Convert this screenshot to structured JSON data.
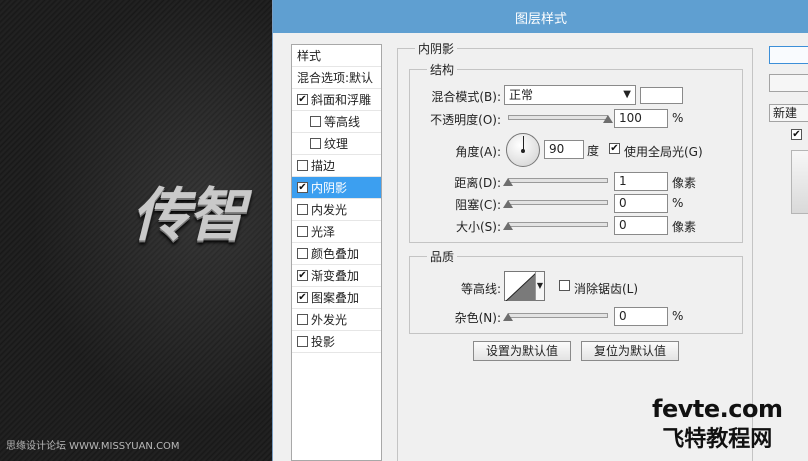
{
  "canvas": {
    "big_text": "传智",
    "watermark": "思缘设计论坛 WWW.MISSYUAN.COM"
  },
  "dialog": {
    "title": "图层样式",
    "styles_list": [
      {
        "label": "样式",
        "checkbox": false,
        "checked": false,
        "indent": 0,
        "selected": false
      },
      {
        "label": "混合选项:默认",
        "checkbox": false,
        "checked": false,
        "indent": 0,
        "selected": false
      },
      {
        "label": "斜面和浮雕",
        "checkbox": true,
        "checked": true,
        "indent": 0,
        "selected": false
      },
      {
        "label": "等高线",
        "checkbox": true,
        "checked": false,
        "indent": 1,
        "selected": false
      },
      {
        "label": "纹理",
        "checkbox": true,
        "checked": false,
        "indent": 1,
        "selected": false
      },
      {
        "label": "描边",
        "checkbox": true,
        "checked": false,
        "indent": 0,
        "selected": false
      },
      {
        "label": "内阴影",
        "checkbox": true,
        "checked": true,
        "indent": 0,
        "selected": true
      },
      {
        "label": "内发光",
        "checkbox": true,
        "checked": false,
        "indent": 0,
        "selected": false
      },
      {
        "label": "光泽",
        "checkbox": true,
        "checked": false,
        "indent": 0,
        "selected": false
      },
      {
        "label": "颜色叠加",
        "checkbox": true,
        "checked": false,
        "indent": 0,
        "selected": false
      },
      {
        "label": "渐变叠加",
        "checkbox": true,
        "checked": true,
        "indent": 0,
        "selected": false
      },
      {
        "label": "图案叠加",
        "checkbox": true,
        "checked": true,
        "indent": 0,
        "selected": false
      },
      {
        "label": "外发光",
        "checkbox": true,
        "checked": false,
        "indent": 0,
        "selected": false
      },
      {
        "label": "投影",
        "checkbox": true,
        "checked": false,
        "indent": 0,
        "selected": false
      }
    ],
    "inner_shadow": {
      "section_title": "内阴影",
      "structure": {
        "title": "结构",
        "blend_mode_label": "混合模式(B):",
        "blend_mode_value": "正常",
        "opacity_label": "不透明度(O):",
        "opacity_value": "100",
        "opacity_slider": 1.0,
        "percent": "%",
        "angle_label": "角度(A):",
        "angle_value": "90",
        "degree_unit": "度",
        "global_light_label": "使用全局光(G)",
        "global_light_checked": true,
        "distance_label": "距离(D):",
        "distance_value": "1",
        "distance_slider": 0.0,
        "choke_label": "阻塞(C):",
        "choke_value": "0",
        "choke_slider": 0.0,
        "size_label": "大小(S):",
        "size_value": "0",
        "size_slider": 0.0,
        "pixel_unit": "像素"
      },
      "quality": {
        "title": "品质",
        "contour_label": "等高线:",
        "anti_alias_label": "消除锯齿(L)",
        "anti_alias_checked": false,
        "noise_label": "杂色(N):",
        "noise_value": "0",
        "noise_slider": 0.0
      },
      "make_default_button": "设置为默认值",
      "reset_default_button": "复位为默认值"
    },
    "side_buttons": {
      "new_style_label": "新建",
      "preview_checked": true
    }
  },
  "logo": {
    "site": "fevte.com",
    "cn": "飞特教程网"
  },
  "colors": {
    "titlebar": "#5f9fd1",
    "selection": "#3c9ff0"
  }
}
